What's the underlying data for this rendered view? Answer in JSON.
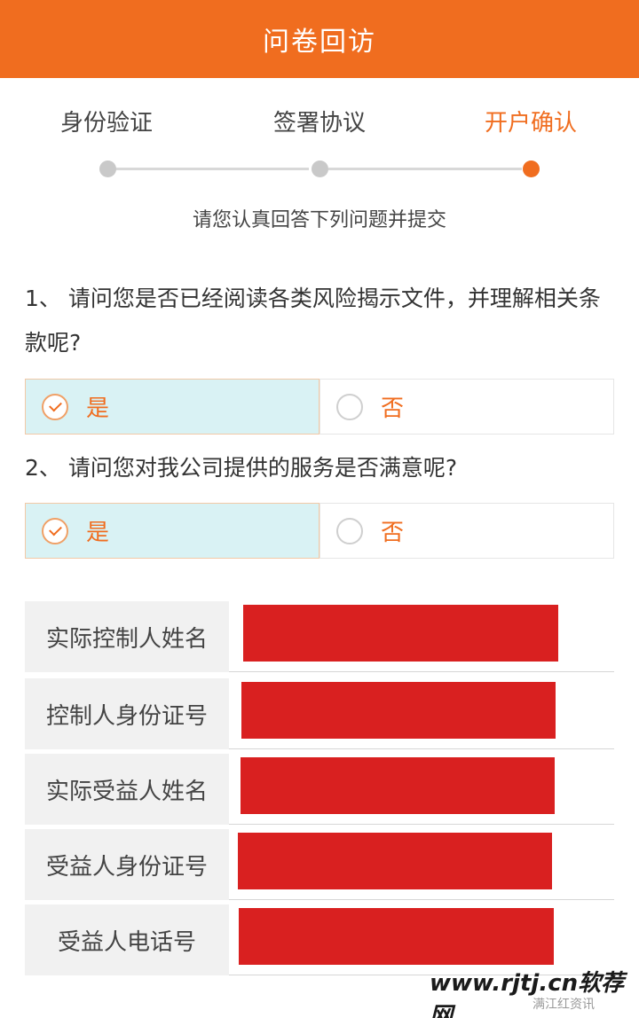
{
  "header": {
    "title": "问卷回访"
  },
  "steps": [
    {
      "label": "身份验证"
    },
    {
      "label": "签署协议"
    },
    {
      "label": "开户确认"
    }
  ],
  "instruction": "请您认真回答下列问题并提交",
  "questions": [
    {
      "text": "1、 请问您是否已经阅读各类风险揭示文件，并理解相关条款呢?",
      "options": [
        "是",
        "否"
      ]
    },
    {
      "text": "2、 请问您对我公司提供的服务是否满意呢?",
      "options": [
        "是",
        "否"
      ]
    }
  ],
  "info_fields": [
    {
      "label": "实际控制人姓名"
    },
    {
      "label": "控制人身份证号"
    },
    {
      "label": "实际受益人姓名"
    },
    {
      "label": "受益人身份证号"
    },
    {
      "label": "受益人电话号"
    }
  ],
  "colors": {
    "accent": "#f06d1f",
    "selected_bg": "#d9f2f4",
    "redacted": "#d92020"
  },
  "watermark": {
    "main": "www.rjtj.cn软荐网",
    "sub": "满江红资讯"
  }
}
